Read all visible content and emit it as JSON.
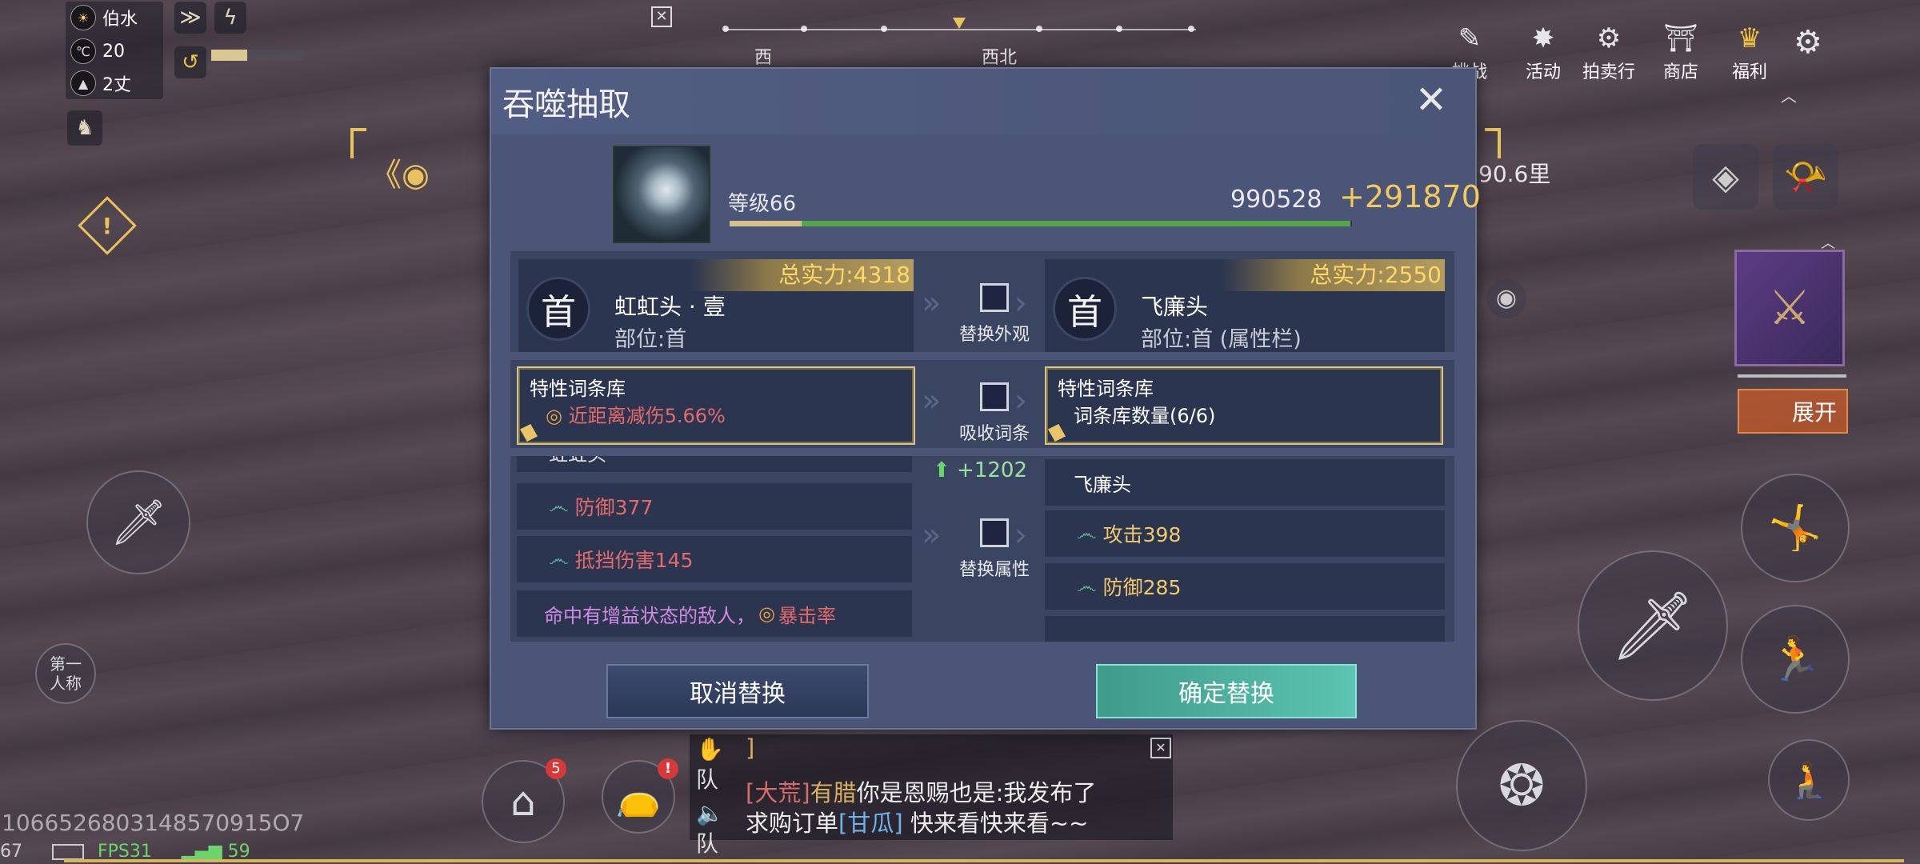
{
  "hud": {
    "weather": "伯水",
    "temperature": "20",
    "depth": "2丈",
    "compass": {
      "dir_left": "西",
      "dir_right": "西北"
    },
    "distance": "90.6里",
    "expand_label": "展开",
    "first_person_label": "第一\n人称",
    "player_id": "1066526803148570915O7",
    "bottom_status": {
      "battery": "67",
      "fps": "FPS31",
      "ping": "59"
    },
    "home_badge": "5",
    "bag_badge": "!",
    "top_menu": [
      {
        "icon": "challenge-icon",
        "label": "挑战"
      },
      {
        "icon": "activity-icon",
        "label": "活动"
      },
      {
        "icon": "auction-icon",
        "label": "拍卖行"
      },
      {
        "icon": "shop-icon",
        "label": "商店"
      },
      {
        "icon": "welfare-icon",
        "label": "福利"
      }
    ]
  },
  "dialog": {
    "title": "吞噬抽取",
    "level": "等级66",
    "exp_current": "990528",
    "exp_gain": "+291870",
    "exp_progress": 0.116,
    "exp_gain_progress": 0.884,
    "left_item": {
      "power": "总实力:4318",
      "name": "虹虹头 · 壹",
      "slot": "部位:首",
      "icon_glyph": "首"
    },
    "right_item": {
      "power": "总实力:2550",
      "name": "飞廉头",
      "slot": "部位:首 (属性栏)",
      "icon_glyph": "首"
    },
    "replace_appearance": "替换外观",
    "absorb_trait": "吸收词条",
    "replace_attr": "替换属性",
    "left_lib": {
      "title": "特性词条库",
      "value": "近距离减伤5.66%"
    },
    "right_lib": {
      "title": "特性词条库",
      "value": "词条库数量(6/6)"
    },
    "attr_gain": "+1202",
    "left_attrs": {
      "header": "虹虹头",
      "rows": [
        "防御377",
        "抵挡伤害145"
      ],
      "note_prefix": "命中有增益状态的敌人，",
      "note_suffix": "暴击率"
    },
    "right_attrs": {
      "header": "飞廉头",
      "rows": [
        "攻击398",
        "防御285"
      ]
    },
    "cancel_label": "取消替换",
    "confirm_label": "确定替换"
  },
  "chat": {
    "line0": "]",
    "line1_channel": "[大荒]",
    "line1_nick": "有腊",
    "line1_text": "你是恩赐也是:我发布了",
    "line2_text_a": "求购订单",
    "line2_item": "[甘瓜]",
    "line2_text_b": " 快来看快来看~~",
    "team_label": "队"
  },
  "colors": {
    "gold": "#f2c95c",
    "red_attr": "#e56a6a",
    "gold_attr": "#f0c968",
    "teal": "#5cc4b0"
  }
}
